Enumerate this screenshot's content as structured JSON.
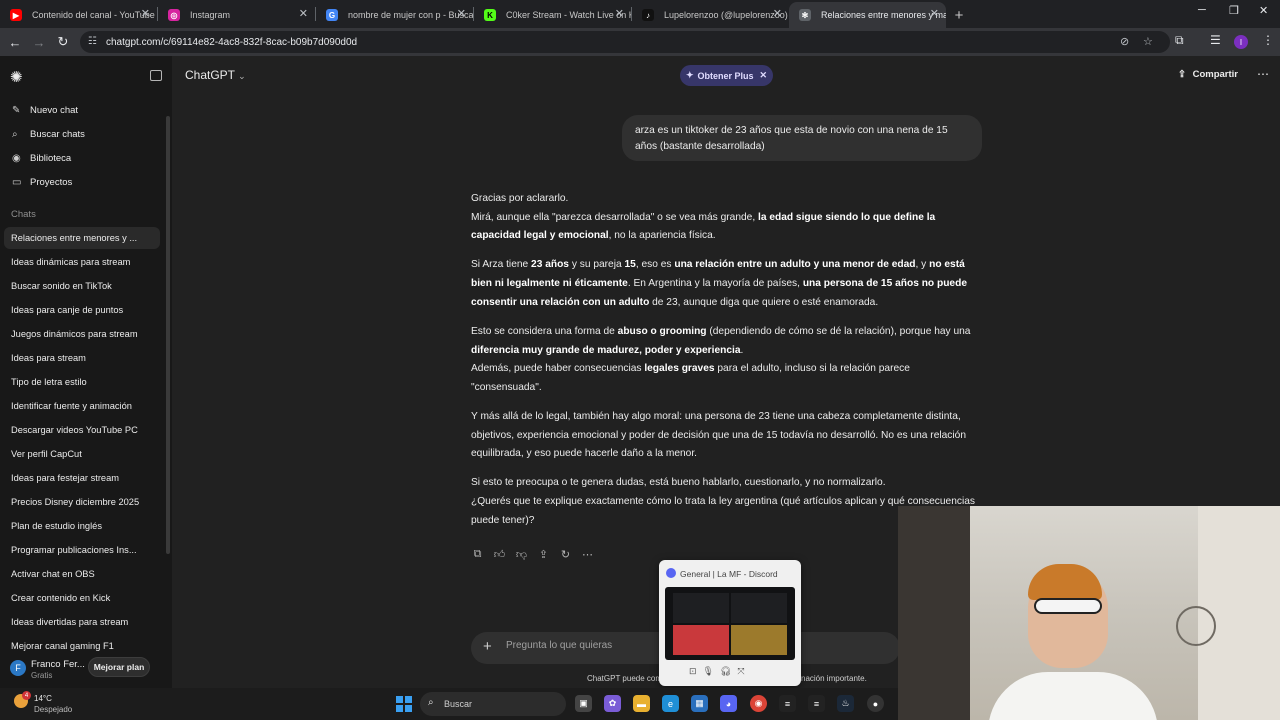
{
  "browser": {
    "tabs": [
      {
        "title": "Contenido del canal - YouTube",
        "icon": "youtube-icon",
        "color": "#ff0000",
        "glyph": "▶",
        "active": false
      },
      {
        "title": "Instagram",
        "icon": "instagram-icon",
        "color": "#d6249f",
        "glyph": "◎",
        "active": false
      },
      {
        "title": "nombre de mujer con p - Busca",
        "icon": "google-icon",
        "color": "#4285f4",
        "glyph": "G",
        "active": false
      },
      {
        "title": "C0ker Stream - Watch Live on K",
        "icon": "kick-icon",
        "color": "#53fc18",
        "glyph": "K",
        "active": false
      },
      {
        "title": "Lupelorenzoo (@lupelorenzoo)",
        "icon": "tiktok-icon",
        "color": "#111111",
        "glyph": "♪",
        "active": false
      },
      {
        "title": "Relaciones entre menores y ma",
        "icon": "chatgpt-icon",
        "color": "#5f6368",
        "glyph": "✻",
        "active": true
      }
    ],
    "new_tab": "+",
    "url": "chatgpt.com/c/69114e82-4ac8-832f-8cac-b09b7d090d0d",
    "profile_initial": "I"
  },
  "sidebar": {
    "nav": [
      {
        "label": "Nuevo chat",
        "icon": "edit-icon",
        "glyph": "✎"
      },
      {
        "label": "Buscar chats",
        "icon": "search-icon",
        "glyph": "⌕"
      },
      {
        "label": "Biblioteca",
        "icon": "library-icon",
        "glyph": "◉"
      },
      {
        "label": "Proyectos",
        "icon": "folder-icon",
        "glyph": "▭"
      }
    ],
    "section_title": "Chats",
    "chats": [
      "Relaciones entre menores y ...",
      "Ideas dinámicas para stream",
      "Buscar sonido en TikTok",
      "Ideas para canje de puntos",
      "Juegos dinámicos para stream",
      "Ideas para stream",
      "Tipo de letra estilo",
      "Identificar fuente y animación",
      "Descargar videos YouTube PC",
      "Ver perfil CapCut",
      "Ideas para festejar stream",
      "Precios Disney diciembre 2025",
      "Plan de estudio inglés",
      "Programar publicaciones Ins...",
      "Activar chat en OBS",
      "Crear contenido en Kick",
      "Ideas divertidas para stream",
      "Mejorar canal gaming F1"
    ],
    "user": {
      "initial": "F",
      "name": "Franco Fer...",
      "plan": "Gratis",
      "upgrade_label": "Mejorar plan"
    }
  },
  "header": {
    "model": "ChatGPT",
    "plus_label": "Obtener Plus",
    "share_label": "Compartir"
  },
  "conversation": {
    "user_message": "arza es un tiktoker de 23 años que esta de novio con una nena de 15 años (bastante desarrollada)",
    "a1_l1": "Gracias por aclararlo.",
    "a1_l2a": "Mirá, aunque ella \"parezca desarrollada\" o se vea más grande, ",
    "a1_l2b": "la edad sigue siendo lo que define la capacidad legal y emocional",
    "a1_l2c": ", no la apariencia física.",
    "a2a": "Si Arza tiene ",
    "a2b": "23 años",
    "a2c": " y su pareja ",
    "a2d": "15",
    "a2e": ", eso es ",
    "a2f": "una relación entre un adulto y una menor de edad",
    "a2g": ", y ",
    "a2h": "no está bien ni legalmente ni éticamente",
    "a2i": ". En Argentina y la mayoría de países, ",
    "a2j": "una persona de 15 años no puede consentir una relación con un adulto",
    "a2k": " de 23, aunque diga que quiere o esté enamorada.",
    "a3a": "Esto se considera una forma de ",
    "a3b": "abuso o grooming",
    "a3c": " (dependiendo de cómo se dé la relación), porque hay una ",
    "a3d": "diferencia muy grande de madurez, poder y experiencia",
    "a3e": ".",
    "a3f": "Además, puede haber consecuencias ",
    "a3g": "legales graves",
    "a3h": " para el adulto, incluso si la relación parece \"consensuada\".",
    "a4": "Y más allá de lo legal, también hay algo moral: una persona de 23 tiene una cabeza completamente distinta, objetivos, experiencia emocional y poder de decisión que una de 15 todavía no desarrolló. No es una relación equilibrada, y eso puede hacerle daño a la menor.",
    "a5_l1": "Si esto te preocupa o te genera dudas, está bueno hablarlo, cuestionarlo, y no normalizarlo.",
    "a5_l2": "¿Querés que te explique exactamente cómo lo trata la ley argentina (qué artículos aplican y qué consecuencias puede tener)?"
  },
  "composer": {
    "placeholder": "Pregunta lo que quieras",
    "disclaimer_left": "ChatGPT puede com",
    "disclaimer_right": "nación importante."
  },
  "discord_preview": {
    "title": "General | La MF - Discord"
  },
  "taskbar": {
    "weather_temp": "14°C",
    "weather_desc": "Despejado",
    "weather_badge": "4",
    "search_label": "Buscar"
  },
  "colors": {
    "accent_plus": "#373669",
    "discord_blurple": "#5865f2",
    "tile_red": "#c9393c",
    "tile_gold": "#9c7a2c"
  }
}
